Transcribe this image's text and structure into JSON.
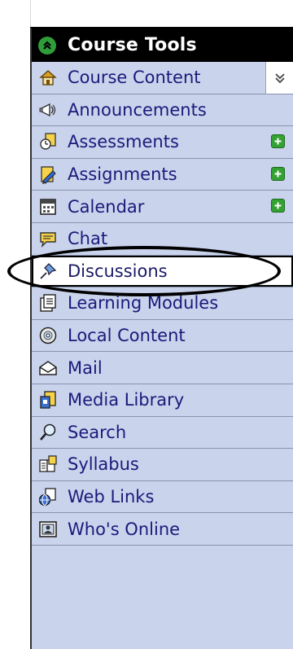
{
  "header": {
    "title": "Course Tools",
    "icon": "double-chevron-up-icon",
    "icon_color": "#2f9e3a"
  },
  "menu": [
    {
      "label": "Course Content",
      "icon": "house-icon",
      "badge": false,
      "collapse": true
    },
    {
      "label": "Announcements",
      "icon": "megaphone-icon",
      "badge": false
    },
    {
      "label": "Assessments",
      "icon": "stopwatch-icon",
      "badge": true
    },
    {
      "label": "Assignments",
      "icon": "pencil-icon",
      "badge": true
    },
    {
      "label": "Calendar",
      "icon": "calendar-icon",
      "badge": true
    },
    {
      "label": "Chat",
      "icon": "speech-bubble-icon",
      "badge": false
    },
    {
      "label": "Discussions",
      "icon": "pushpin-icon",
      "badge": false,
      "active": true
    },
    {
      "label": "Learning Modules",
      "icon": "document-stack-icon",
      "badge": false
    },
    {
      "label": "Local Content",
      "icon": "cd-icon",
      "badge": false
    },
    {
      "label": "Mail",
      "icon": "envelope-icon",
      "badge": false
    },
    {
      "label": "Media Library",
      "icon": "media-icon",
      "badge": false
    },
    {
      "label": "Search",
      "icon": "magnifier-icon",
      "badge": false
    },
    {
      "label": "Syllabus",
      "icon": "book-icon",
      "badge": false
    },
    {
      "label": "Web Links",
      "icon": "globe-icon",
      "badge": false
    },
    {
      "label": "Who's Online",
      "icon": "person-card-icon",
      "badge": false
    }
  ],
  "colors": {
    "panel_bg": "#c9d3ec",
    "label": "#1a1a7a",
    "badge": "#33a233"
  }
}
